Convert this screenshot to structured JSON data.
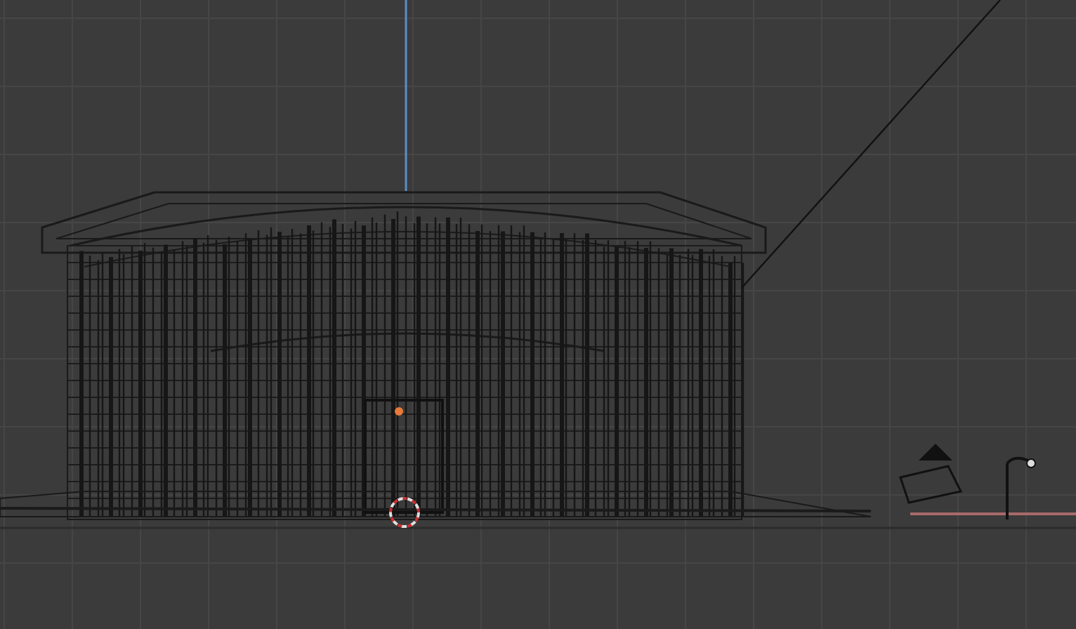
{
  "viewport": {
    "kind": "wireframe"
  }
}
